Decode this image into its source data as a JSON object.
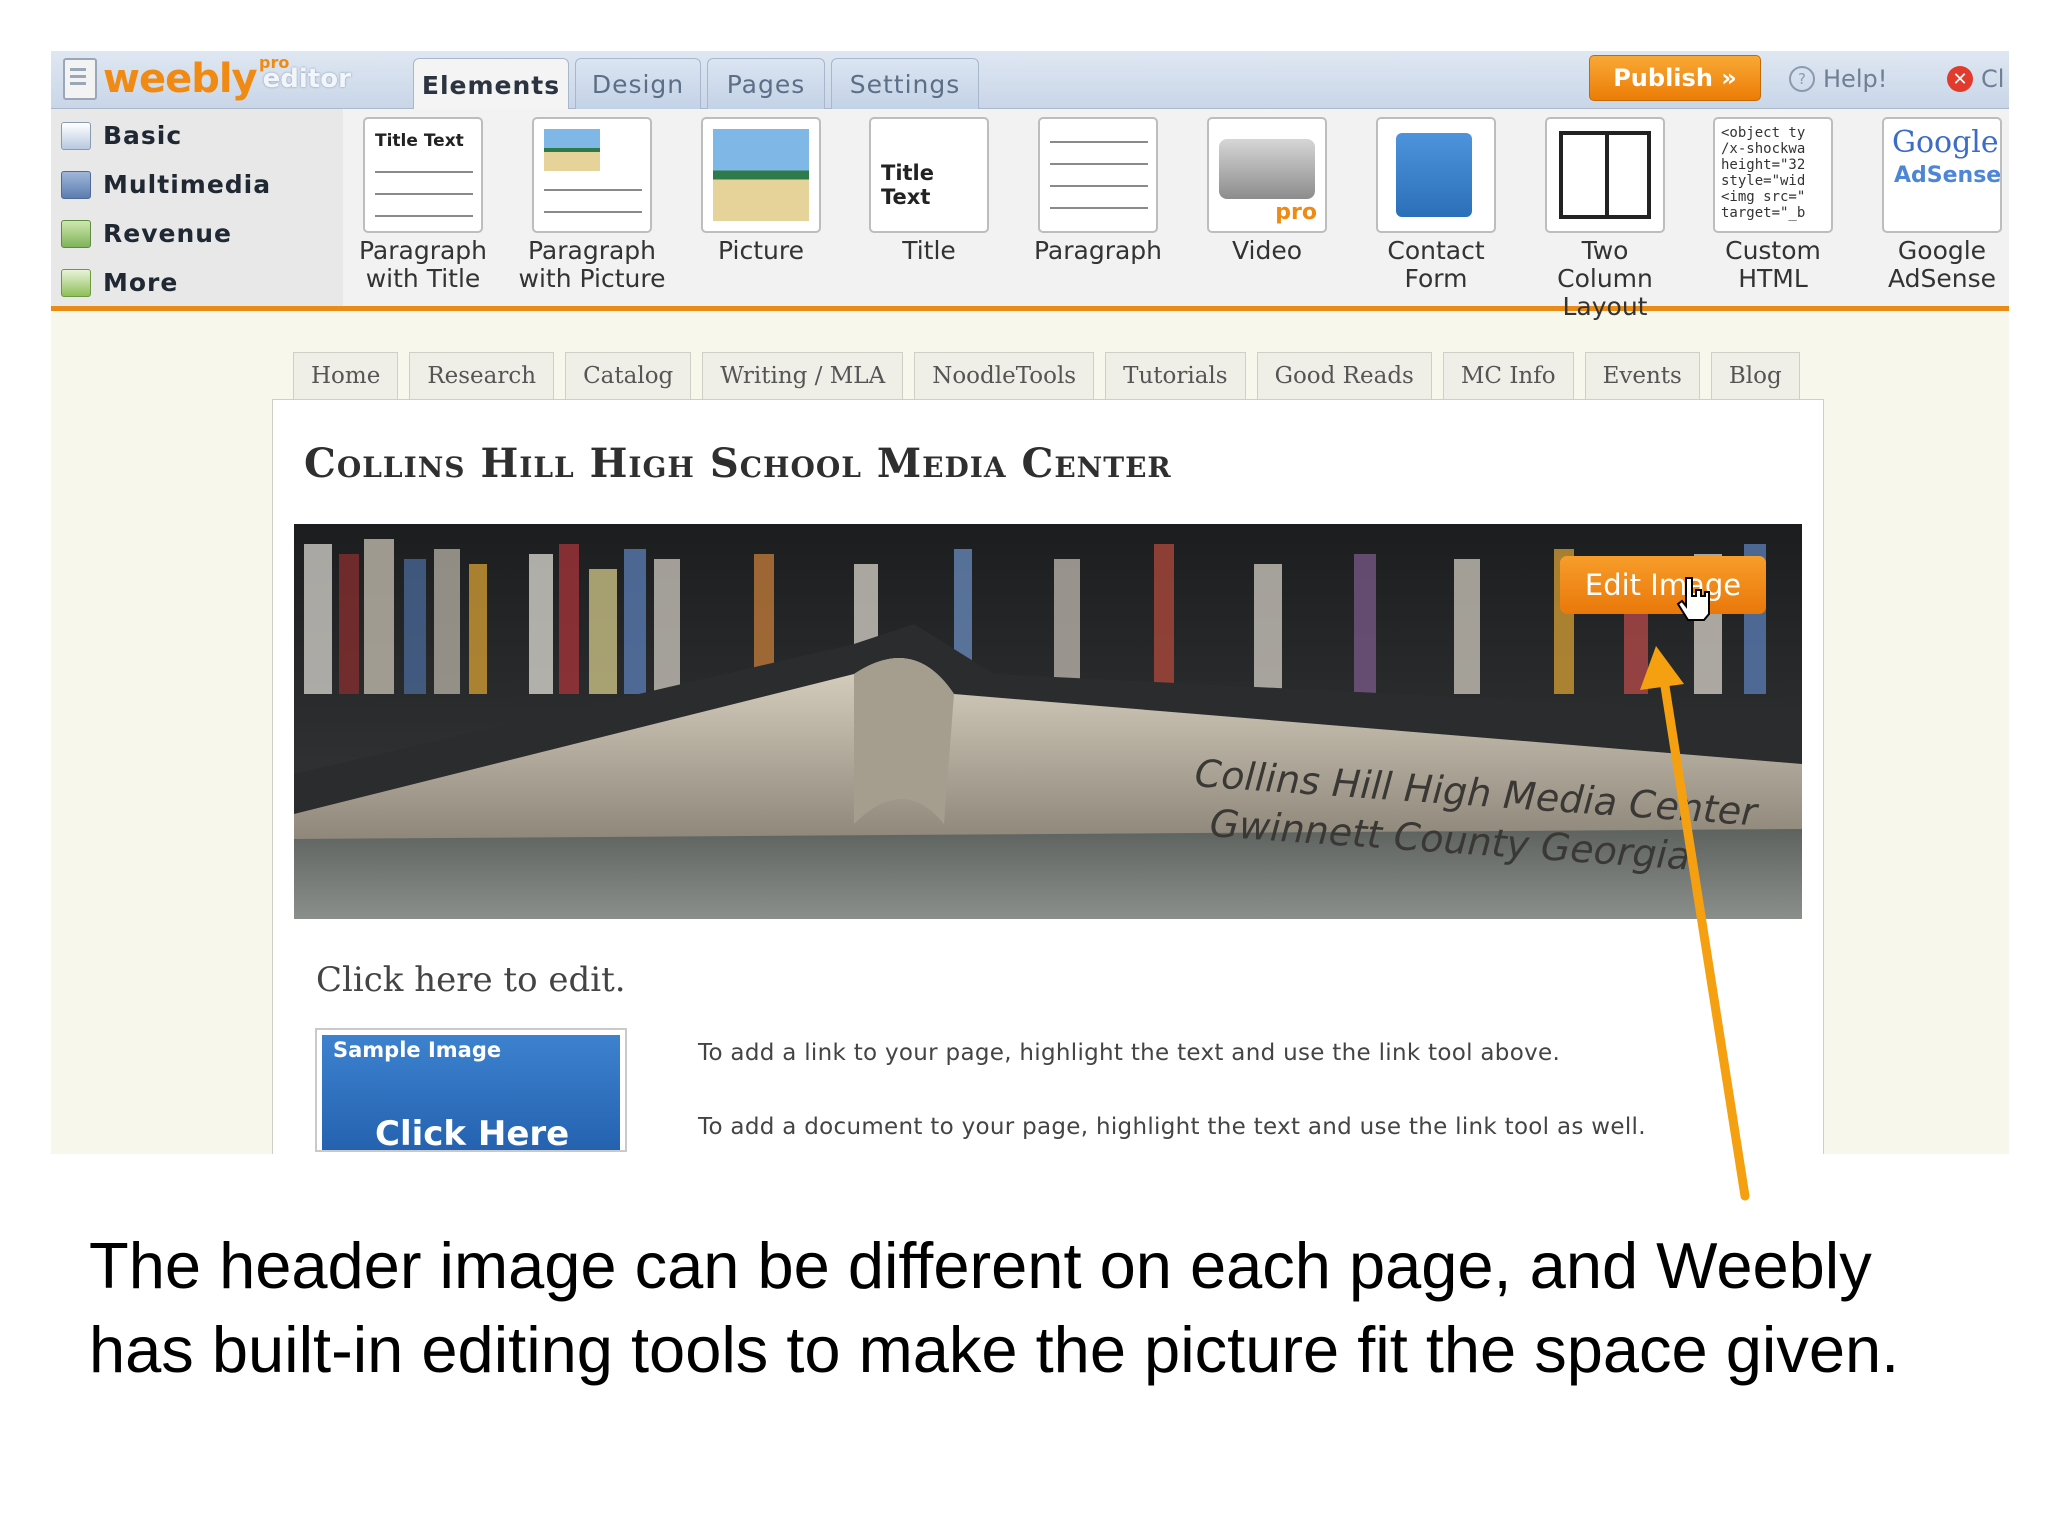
{
  "editor": {
    "logo_word": "weebly",
    "logo_pro": "pro",
    "logo_editor": "editor",
    "tabs": [
      "Elements",
      "Design",
      "Pages",
      "Settings"
    ],
    "publish_label": "Publish »",
    "help_label": "Help!",
    "close_label": "Cl",
    "categories": [
      "Basic",
      "Multimedia",
      "Revenue",
      "More"
    ],
    "elements": [
      {
        "label": "Paragraph with Title",
        "thumb_title": "Title Text"
      },
      {
        "label": "Paragraph with Picture"
      },
      {
        "label": "Picture"
      },
      {
        "label": "Title",
        "thumb_title": "Title Text"
      },
      {
        "label": "Paragraph"
      },
      {
        "label": "Video",
        "thumb_badge": "pro"
      },
      {
        "label": "Contact Form"
      },
      {
        "label": "Two Column Layout"
      },
      {
        "label": "Custom HTML",
        "thumb_code": "<object ty\n/x-shockwa\nheight=\"32\nstyle=\"wid\n<img src=\"\ntarget=\"_b"
      },
      {
        "label": "Google AdSense",
        "thumb_google": "Google",
        "thumb_adsense": "AdSense"
      }
    ]
  },
  "site": {
    "nav": [
      "Home",
      "Research",
      "Catalog",
      "Writing / MLA",
      "NoodleTools",
      "Tutorials",
      "Good Reads",
      "MC Info",
      "Events",
      "Blog"
    ],
    "title": "Collins Hill High School Media Center",
    "header_image_text_line1": "Collins Hill High Media Center",
    "header_image_text_line2": "Gwinnett County Georgia",
    "edit_image_label": "Edit Image",
    "click_to_edit": "Click here to edit.",
    "sample_image_label": "Sample Image",
    "sample_image_cta": "Click Here",
    "link_help": "To add a link to your page, highlight the text and use the link tool above.",
    "doc_help": "To add a document to your page, highlight the text and use the link tool as well."
  },
  "caption": "The header image can be different on each page, and Weebly has built-in editing tools to make the picture fit the space given.",
  "colors": {
    "accent_orange": "#ec7d06",
    "arrow": "#f5a011",
    "editor_blue": "#c9d6e8"
  }
}
